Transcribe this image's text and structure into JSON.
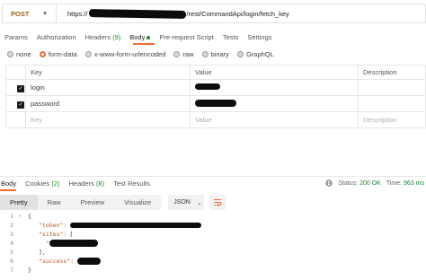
{
  "request": {
    "method": "POST",
    "url_prefix": "https://",
    "url_suffix": "/rest/CommandApi/login/fetch_key"
  },
  "request_tabs": [
    {
      "label": "Params"
    },
    {
      "label": "Authorization"
    },
    {
      "label": "Headers",
      "count": "(9)"
    },
    {
      "label": "Body"
    },
    {
      "label": "Pre-request Script"
    },
    {
      "label": "Tests"
    },
    {
      "label": "Settings"
    }
  ],
  "body_types": [
    "none",
    "form-data",
    "x-www-form-urlencoded",
    "raw",
    "binary",
    "GraphQL"
  ],
  "body_type_selected": "form-data",
  "table": {
    "headers": {
      "key": "Key",
      "value": "Value",
      "description": "Description"
    },
    "rows": [
      {
        "key": "login",
        "checked": true
      },
      {
        "key": "password",
        "checked": true
      }
    ],
    "placeholder": {
      "key": "Key",
      "value": "Value",
      "description": "Description"
    }
  },
  "response_tabs": [
    {
      "label": "Body"
    },
    {
      "label": "Cookies",
      "count": "(2)"
    },
    {
      "label": "Headers",
      "count": "(8)"
    },
    {
      "label": "Test Results"
    }
  ],
  "status": {
    "status_label": "Status:",
    "status_value": "200 OK",
    "time_label": "Time:",
    "time_value": "963 ms"
  },
  "view_modes": [
    "Pretty",
    "Raw",
    "Preview",
    "Visualize"
  ],
  "view_mode_selected": "Pretty",
  "format": "JSON",
  "code": {
    "line_numbers": [
      "1",
      "2",
      "3",
      "4",
      "5",
      "6",
      "7"
    ],
    "open_brace": "{",
    "token_key": "\"token\":",
    "sites_key": "\"sites\":",
    "open_bracket": "[",
    "quote": "\"",
    "close_bracket": "],",
    "success_key": "\"success\":",
    "close_brace": "}"
  },
  "colors": {
    "accent": "#f26b3a",
    "method": "#a35f12",
    "ok": "#1d8a2e",
    "json_key": "#b35a1f"
  }
}
